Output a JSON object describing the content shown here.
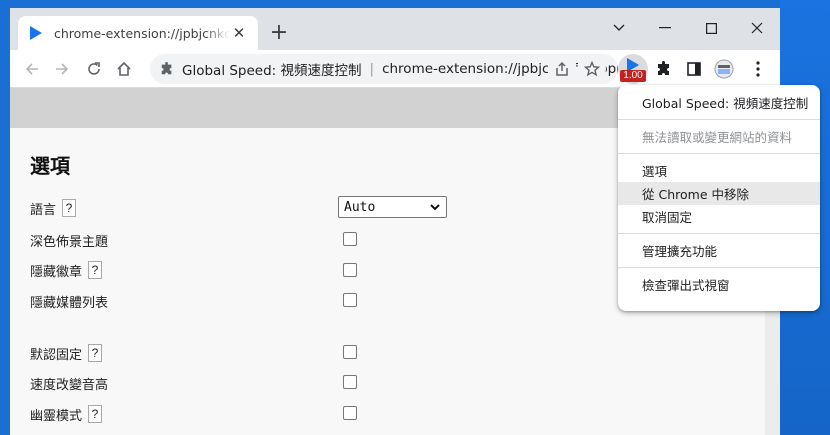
{
  "tab": {
    "title": "chrome-extension://jpbjcnkcffbooppibceonlgknpkniiff/options.html",
    "close_glyph": "✕",
    "favicon": "play-triangle-icon"
  },
  "newtab_glyph": "+",
  "window_controls": {
    "tabsearch": "⌵",
    "minimize": "—",
    "maximize": "☐",
    "close": "✕"
  },
  "toolbar": {
    "extension_name": "Global Speed: 視頻速度控制",
    "url": "chrome-extension://jpbjcnkcffbooppibceonlgknpkniiff/options.html",
    "badge": "1.00",
    "icons": [
      "back-arrow-icon",
      "forward-arrow-icon",
      "reload-icon",
      "home-icon",
      "share-icon",
      "star-icon",
      "extension-icon",
      "puzzle-icon",
      "sidepanel-icon",
      "profile-icon",
      "kebab-menu-icon"
    ]
  },
  "options": {
    "title": "選項",
    "language_label": "語言",
    "language_value": "Auto",
    "dark_theme_label": "深色佈景主題",
    "hide_badge_label": "隱藏徽章",
    "hide_media_list_label": "隱藏媒體列表",
    "default_pinned_label": "默認固定",
    "speed_changes_pitch_label": "速度改變音高",
    "ghost_mode_label": "幽靈模式",
    "help_glyph": "?"
  },
  "context_menu": {
    "items": [
      {
        "label": "Global Speed: 視頻速度控制",
        "disabled": false
      },
      {
        "label": "無法讀取或變更網站的資料",
        "disabled": true
      },
      {
        "label": "選項",
        "disabled": false
      },
      {
        "label": "從 Chrome 中移除",
        "disabled": false,
        "hover": true
      },
      {
        "label": "取消固定",
        "disabled": false
      },
      {
        "label": "管理擴充功能",
        "disabled": false
      },
      {
        "label": "檢查彈出式視窗",
        "disabled": false
      }
    ]
  },
  "colors": {
    "desktop": "#1a6fd4",
    "tabstrip": "#dee1e6",
    "badge": "#c5221f",
    "extension_blue": "#1a73e8"
  }
}
